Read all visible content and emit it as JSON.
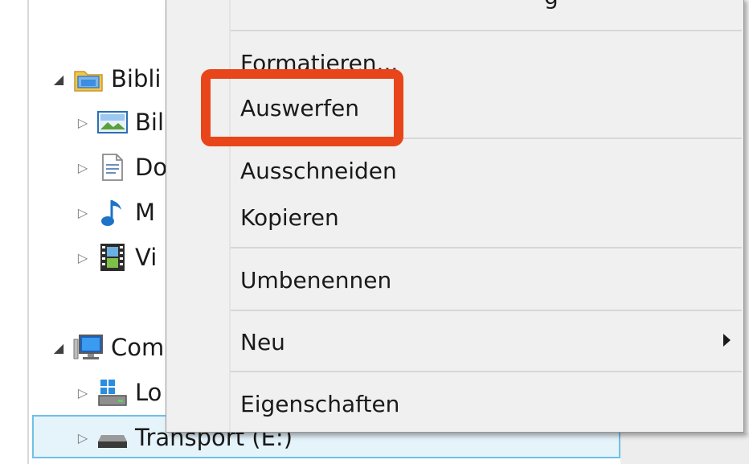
{
  "tree": {
    "libraries": {
      "label": "Bibli"
    },
    "pictures": {
      "label": "Bil"
    },
    "documents": {
      "label": "Do"
    },
    "music": {
      "label": "M"
    },
    "videos": {
      "label": "Vi"
    },
    "computer": {
      "label": "Com"
    },
    "local_disk": {
      "label": "Lo"
    },
    "transport": {
      "label": "Transport (E:)"
    }
  },
  "context_menu": {
    "top_cut_text": "g",
    "items": [
      {
        "label": "Formatieren..."
      },
      {
        "label": "Auswerfen"
      },
      {
        "label": "Ausschneiden"
      },
      {
        "label": "Kopieren"
      },
      {
        "label": "Umbenennen"
      },
      {
        "label": "Neu"
      },
      {
        "label": "Eigenschaften"
      }
    ]
  },
  "colors": {
    "highlight": "#e8461a",
    "selection_fill": "#e5f3fb",
    "selection_border": "#70c0e7",
    "menu_bg": "#f0f0f0"
  }
}
